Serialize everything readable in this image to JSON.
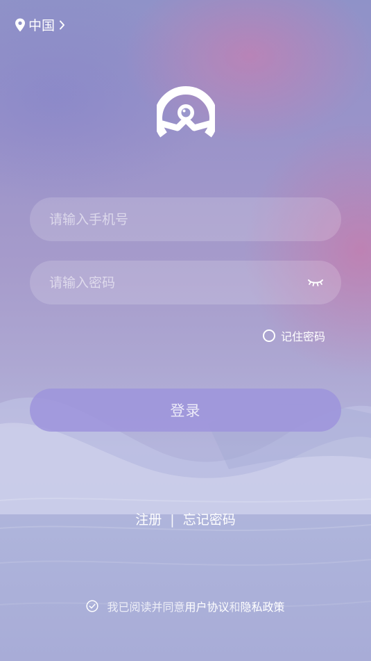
{
  "location": {
    "region": "中国"
  },
  "login_form": {
    "phone_placeholder": "请输入手机号",
    "password_placeholder": "请输入密码",
    "remember_label": "记住密码",
    "login_button": "登录"
  },
  "links": {
    "register": "注册",
    "separator": "|",
    "forgot_password": "忘记密码"
  },
  "agreement": {
    "prefix": "我已阅读并同意",
    "user_agreement": "用户协议",
    "conjunction": "和",
    "privacy_policy": "隐私政策"
  },
  "icons": {
    "location": "location-pin-icon",
    "region_chevron": "chevron-right-icon",
    "logo": "app-logo-icon",
    "password_visibility": "eye-closed-icon",
    "agreement_check": "check-circle-icon"
  },
  "colors": {
    "login_button": "#9e94dc",
    "text": "#ffffff"
  }
}
